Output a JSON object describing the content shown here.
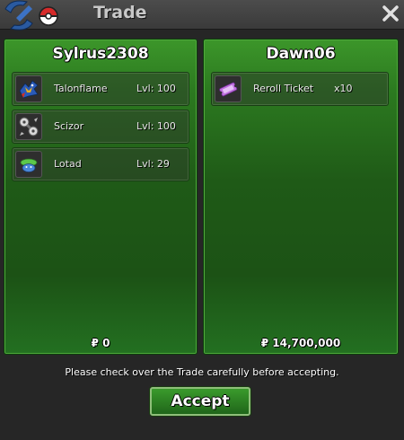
{
  "window": {
    "title": "Trade",
    "close_icon": "close-icon"
  },
  "left_panel": {
    "username": "Sylrus2308",
    "items": [
      {
        "name": "Talonflame",
        "level": "Lvl: 100",
        "icon": "talonflame-sprite-icon"
      },
      {
        "name": "Scizor",
        "level": "Lvl: 100",
        "icon": "scizor-sprite-icon"
      },
      {
        "name": "Lotad",
        "level": "Lvl: 29",
        "icon": "lotad-sprite-icon"
      }
    ],
    "money": "₽ 0"
  },
  "right_panel": {
    "username": "Dawn06",
    "items": [
      {
        "name": "Reroll Ticket",
        "quantity": "x10",
        "icon": "reroll-ticket-icon"
      }
    ],
    "money": "₽ 14,700,000"
  },
  "footer": {
    "notice": "Please check over the Trade carefully before accepting.",
    "accept_label": "Accept"
  },
  "colors": {
    "panel_green": "#2c7a20",
    "title_gray": "#c8c8c8",
    "accept_green": "#3a9a2c",
    "pokeball_red": "#d62a2a",
    "logo_blue": "#2a5aa0"
  }
}
